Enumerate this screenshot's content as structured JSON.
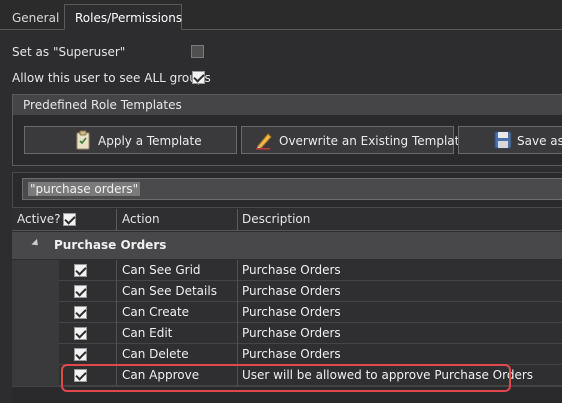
{
  "tabs": [
    {
      "label": "General",
      "active": false
    },
    {
      "label": "Roles/Permissions",
      "active": true
    }
  ],
  "options": {
    "superuser_label": "Set as \"Superuser\"",
    "superuser_checked": false,
    "all_groups_label": "Allow this user to see ALL groups",
    "all_groups_checked": true
  },
  "templates": {
    "title": "Predefined Role Templates",
    "buttons": [
      {
        "label": "Apply a Template",
        "icon": "clipboard-icon"
      },
      {
        "label": "Overwrite an Existing Template",
        "icon": "pencil-icon"
      },
      {
        "label": "Save as",
        "icon": "floppy-disk-icon"
      }
    ]
  },
  "filter": {
    "value": "\"purchase orders\""
  },
  "grid": {
    "columns": {
      "active": "Active?",
      "action": "Action",
      "description": "Description"
    },
    "header_checkbox_checked": true,
    "group": "Purchase Orders",
    "rows": [
      {
        "active": true,
        "action": "Can See Grid",
        "description": "Purchase Orders"
      },
      {
        "active": true,
        "action": "Can See Details",
        "description": "Purchase Orders"
      },
      {
        "active": true,
        "action": "Can Create",
        "description": "Purchase Orders"
      },
      {
        "active": true,
        "action": "Can Edit",
        "description": "Purchase Orders"
      },
      {
        "active": true,
        "action": "Can Delete",
        "description": "Purchase Orders"
      },
      {
        "active": true,
        "action": "Can Approve",
        "description": "User will be allowed to approve Purchase Orders"
      }
    ]
  },
  "colors": {
    "highlight": "#e0484e",
    "background": "#2d2d30"
  }
}
